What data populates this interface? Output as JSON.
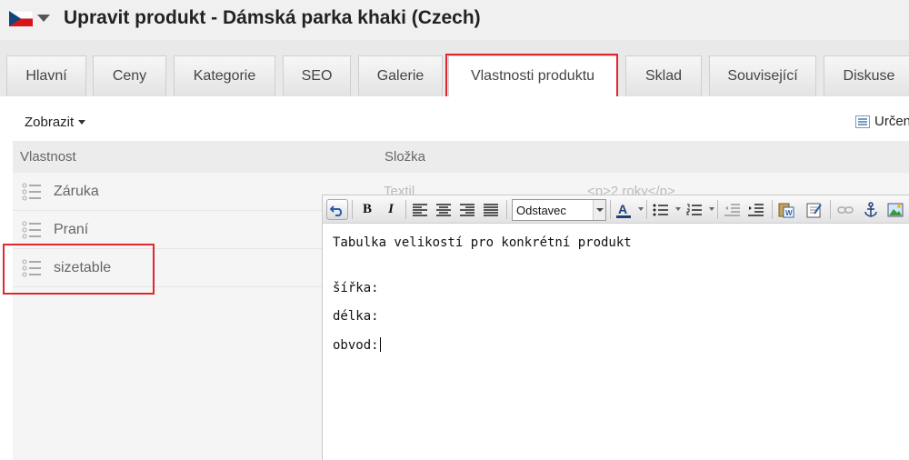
{
  "header": {
    "title": "Upravit produkt - Dámská parka khaki (Czech)",
    "flag_icon": "czech-flag-icon"
  },
  "tabs": [
    {
      "label": "Hlavní"
    },
    {
      "label": "Ceny"
    },
    {
      "label": "Kategorie"
    },
    {
      "label": "SEO"
    },
    {
      "label": "Galerie"
    },
    {
      "label": "Vlastnosti produktu",
      "active": true
    },
    {
      "label": "Sklad"
    },
    {
      "label": "Související"
    },
    {
      "label": "Diskuse"
    }
  ],
  "toolbar": {
    "view_label": "Zobrazit",
    "right_label": "Určen"
  },
  "grid": {
    "columns": [
      "Vlastnost",
      "Složka"
    ],
    "rows": [
      {
        "label": "Záruka",
        "type": "Textil",
        "value": "<p>2 roky</p>"
      },
      {
        "label": "Praní"
      },
      {
        "label": "sizetable"
      }
    ]
  },
  "editor": {
    "format_value": "Odstavec",
    "buttons": {
      "bold": "B",
      "italic": "I"
    },
    "content": [
      "Tabulka velikostí pro konkrétní produkt",
      "šířka:",
      "délka:",
      "obvod:"
    ]
  },
  "colors": {
    "highlight": "#e1262d",
    "header_bg": "#f0f0f0"
  }
}
